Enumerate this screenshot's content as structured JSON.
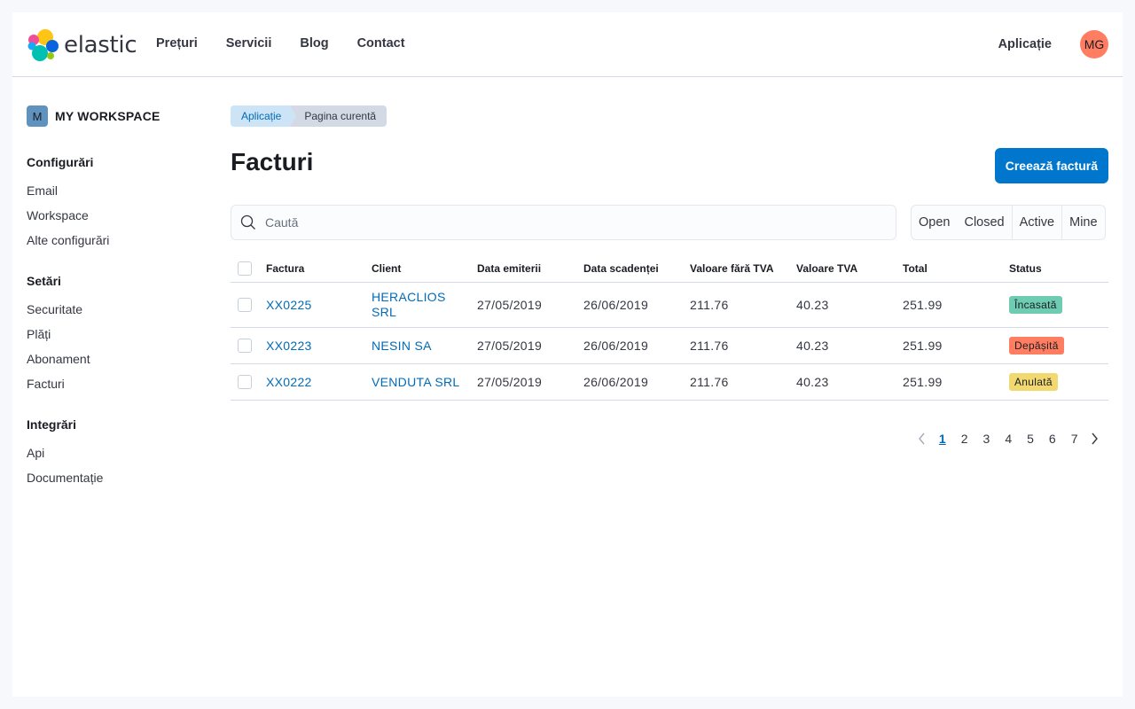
{
  "brand": {
    "name": "elastic"
  },
  "nav": {
    "items": [
      "Prețuri",
      "Servicii",
      "Blog",
      "Contact"
    ]
  },
  "header": {
    "app_link": "Aplicație",
    "avatar_initials": "MG",
    "avatar_color": "#ff7e62"
  },
  "sidebar": {
    "workspace_initial": "M",
    "workspace_name": "MY WORKSPACE",
    "groups": [
      {
        "title": "Configurări",
        "items": [
          "Email",
          "Workspace",
          "Alte configurări"
        ]
      },
      {
        "title": "Setări",
        "items": [
          "Securitate",
          "Plăți",
          "Abonament",
          "Facturi"
        ]
      },
      {
        "title": "Integrări",
        "items": [
          "Api",
          "Documentație"
        ]
      }
    ]
  },
  "breadcrumb": {
    "items": [
      "Aplicație",
      "Pagina curentă"
    ]
  },
  "page": {
    "title": "Facturi",
    "create_button": "Creează factură"
  },
  "search": {
    "placeholder": "Caută",
    "value": ""
  },
  "filters": [
    "Open",
    "Closed",
    "Active",
    "Mine"
  ],
  "table": {
    "columns": [
      "Factura",
      "Client",
      "Data emiterii",
      "Data scadenței",
      "Valoare fără TVA",
      "Valoare TVA",
      "Total",
      "Status"
    ],
    "rows": [
      {
        "invoice": "XX0225",
        "client_line1": "HERACLIOS",
        "client_line2": "SRL",
        "issued": "27/05/2019",
        "due": "26/06/2019",
        "net": "211.76",
        "vat": "40.23",
        "total": "251.99",
        "status": "Încasată",
        "status_color": "#6dccb1"
      },
      {
        "invoice": "XX0223",
        "client_line1": "NESIN SA",
        "client_line2": "",
        "issued": "27/05/2019",
        "due": "26/06/2019",
        "net": "211.76",
        "vat": "40.23",
        "total": "251.99",
        "status": "Depășită",
        "status_color": "#ff7e62"
      },
      {
        "invoice": "XX0222",
        "client_line1": "VENDUTA SRL",
        "client_line2": "",
        "issued": "27/05/2019",
        "due": "26/06/2019",
        "net": "211.76",
        "vat": "40.23",
        "total": "251.99",
        "status": "Anulată",
        "status_color": "#f1d86f"
      }
    ]
  },
  "pagination": {
    "pages": [
      "1",
      "2",
      "3",
      "4",
      "5",
      "6",
      "7"
    ],
    "current": "1"
  },
  "colors": {
    "accent": "#0077cc",
    "link": "#006bb8"
  }
}
